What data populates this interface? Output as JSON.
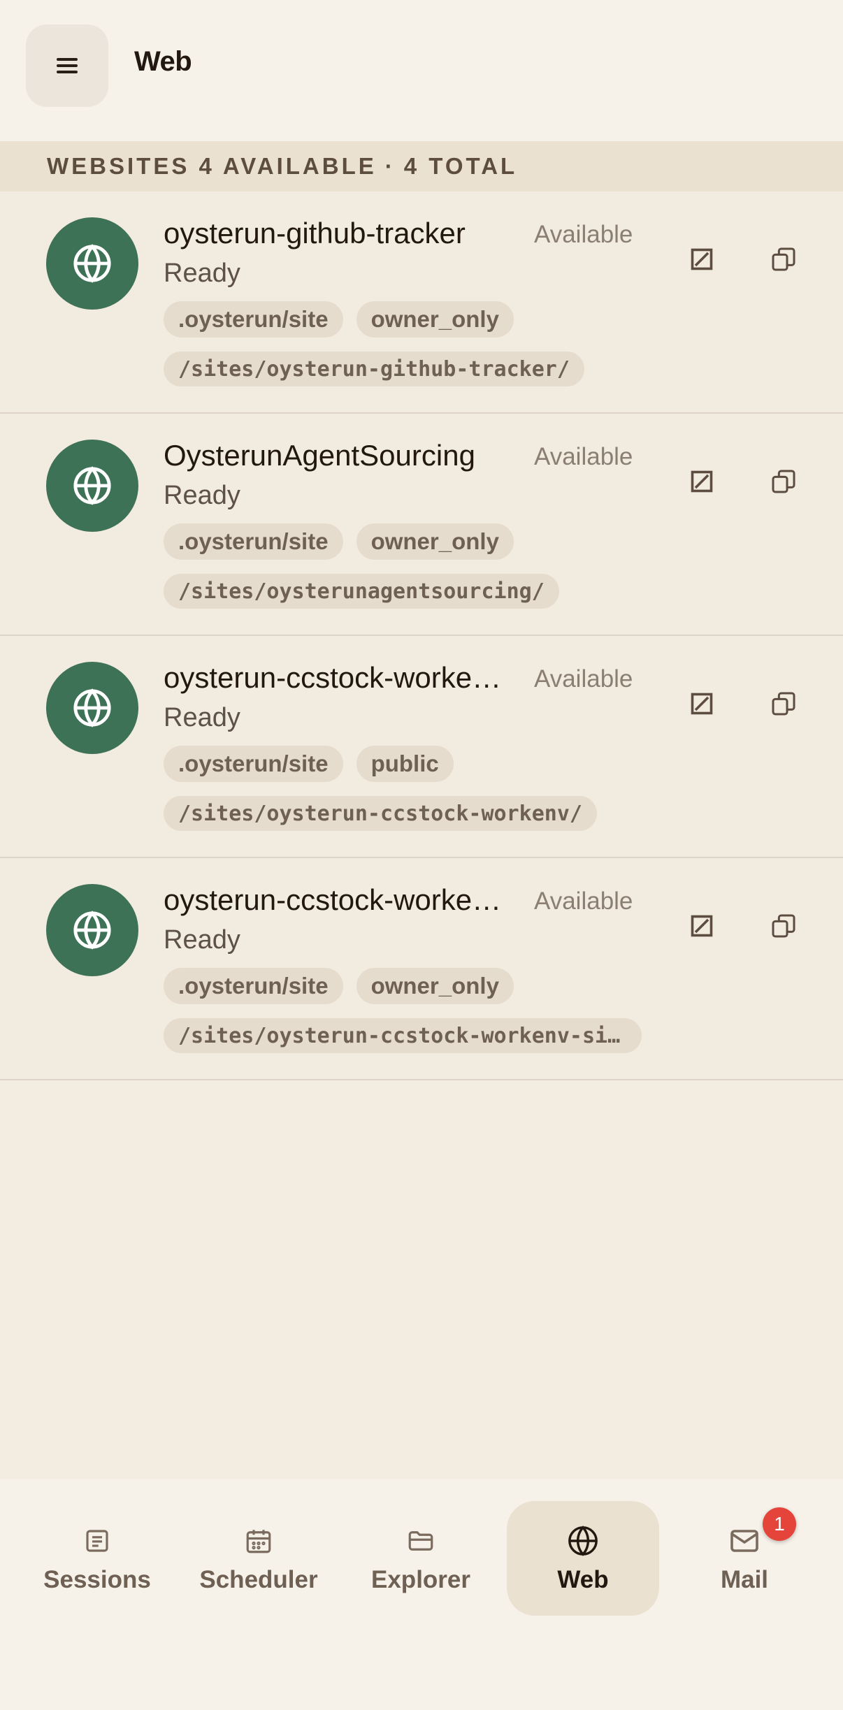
{
  "header": {
    "title": "Web",
    "menu_icon": "hamburger-menu-icon"
  },
  "section": {
    "label": "Websites",
    "available": "4 available",
    "separator": "·",
    "total": "4 total"
  },
  "sites": [
    {
      "name": "oysterun-github-tracker",
      "state": "Available",
      "status": "Ready",
      "tags": [
        ".oysterun/site",
        "owner_only"
      ],
      "path": "/sites/oysterun-github-tracker/"
    },
    {
      "name": "OysterunAgentSourcing",
      "state": "Available",
      "status": "Ready",
      "tags": [
        ".oysterun/site",
        "owner_only"
      ],
      "path": "/sites/oysterunagentsourcing/"
    },
    {
      "name": "oysterun-ccstock-workenv/",
      "state": "Available",
      "status": "Ready",
      "tags": [
        ".oysterun/site",
        "public"
      ],
      "path": "/sites/oysterun-ccstock-workenv/"
    },
    {
      "name": "oysterun-ccstock-workenv-site",
      "state": "Available",
      "status": "Ready",
      "tags": [
        ".oysterun/site",
        "owner_only"
      ],
      "path": "/sites/oysterun-ccstock-workenv-site/"
    }
  ],
  "nav": {
    "items": [
      {
        "label": "Sessions",
        "icon": "document-lines-icon"
      },
      {
        "label": "Scheduler",
        "icon": "calendar-icon"
      },
      {
        "label": "Explorer",
        "icon": "folder-icon"
      },
      {
        "label": "Web",
        "icon": "globe-icon"
      },
      {
        "label": "Mail",
        "icon": "mail-icon",
        "badge": "1"
      }
    ],
    "active": "Web"
  },
  "colors": {
    "accent": "#3e7257",
    "badge": "#e4443a",
    "background": "#f2ece1"
  }
}
